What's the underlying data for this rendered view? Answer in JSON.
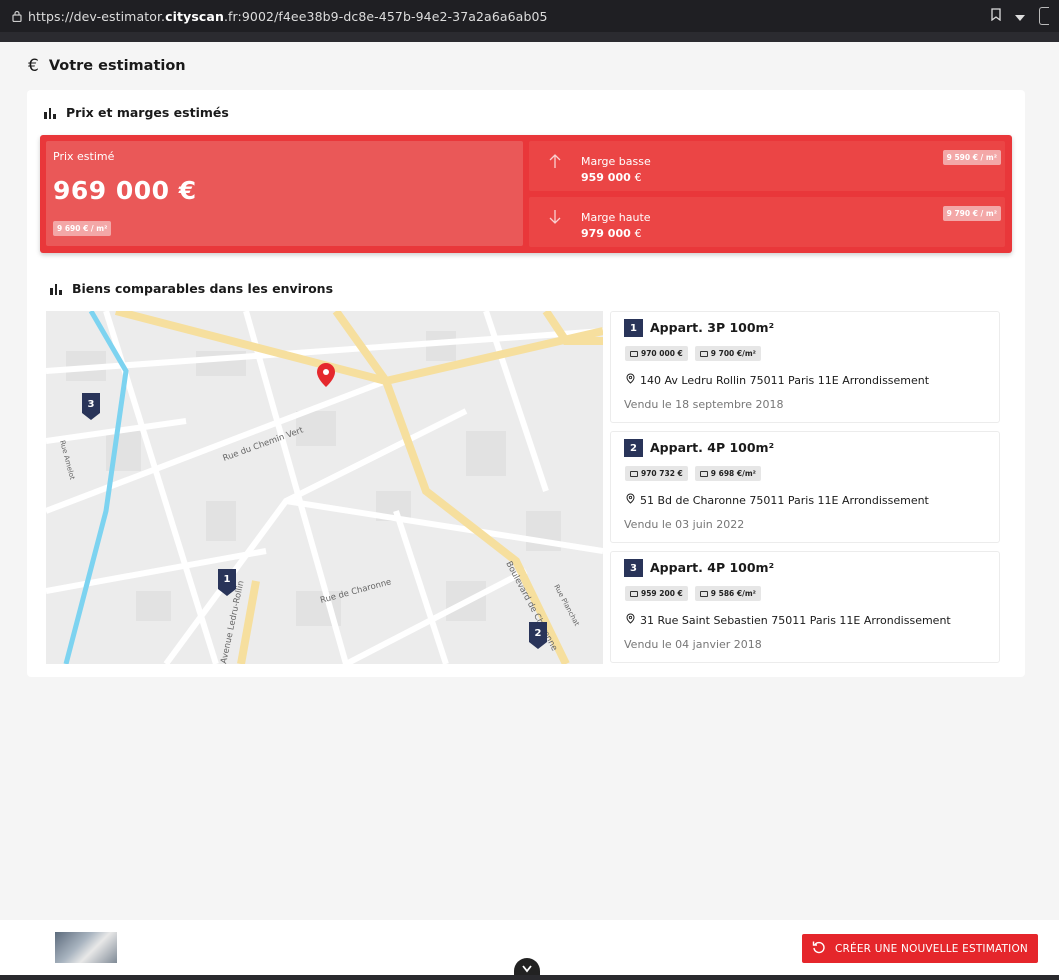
{
  "browser": {
    "url_prefix": "https://dev-estimator.",
    "url_domain": "cityscan",
    "url_suffix": ".fr:9002/f4ee38b9-dc8e-457b-94e2-37a2a6a6ab05"
  },
  "header": {
    "title": "Votre estimation",
    "icon": "€"
  },
  "estimate": {
    "section_title": "Prix et marges estimés",
    "price_label": "Prix estimé",
    "price_value": "969 000 €",
    "price_per_m2": "9 690 € / m²",
    "low": {
      "label": "Marge basse",
      "value": "959 000",
      "currency": "€",
      "per_m2": "9 590 € / m²"
    },
    "high": {
      "label": "Marge haute",
      "value": "979 000",
      "currency": "€",
      "per_m2": "9 790 € / m²"
    }
  },
  "comparables": {
    "section_title": "Biens comparables dans les environs",
    "items": [
      {
        "num": "1",
        "title": "Appart. 3P 100m²",
        "price": "970 000 €",
        "per_m2": "9 700 €/m²",
        "address": "140 Av Ledru Rollin 75011 Paris 11E Arrondissement",
        "date": "Vendu le 18 septembre 2018"
      },
      {
        "num": "2",
        "title": "Appart. 4P 100m²",
        "price": "970 732 €",
        "per_m2": "9 698 €/m²",
        "address": "51 Bd de Charonne 75011 Paris 11E Arrondissement",
        "date": "Vendu le 03 juin 2022"
      },
      {
        "num": "3",
        "title": "Appart. 4P 100m²",
        "price": "959 200 €",
        "per_m2": "9 586 €/m²",
        "address": "31 Rue Saint Sebastien 75011 Paris 11E Arrondissement",
        "date": "Vendu le 04 janvier 2018"
      }
    ]
  },
  "map": {
    "streets": [
      "Rue du Chemin Vert",
      "Rue de Charonne",
      "Boulevard de Charonne",
      "Rue Planchat",
      "Rue Amelot",
      "Avenue Ledru-Rollin"
    ],
    "markers": [
      "1",
      "2",
      "3"
    ]
  },
  "footer": {
    "new_button": "CRÉER UNE NOUVELLE ESTIMATION"
  },
  "colors": {
    "accent": "#e9373a",
    "marker": "#293459"
  }
}
